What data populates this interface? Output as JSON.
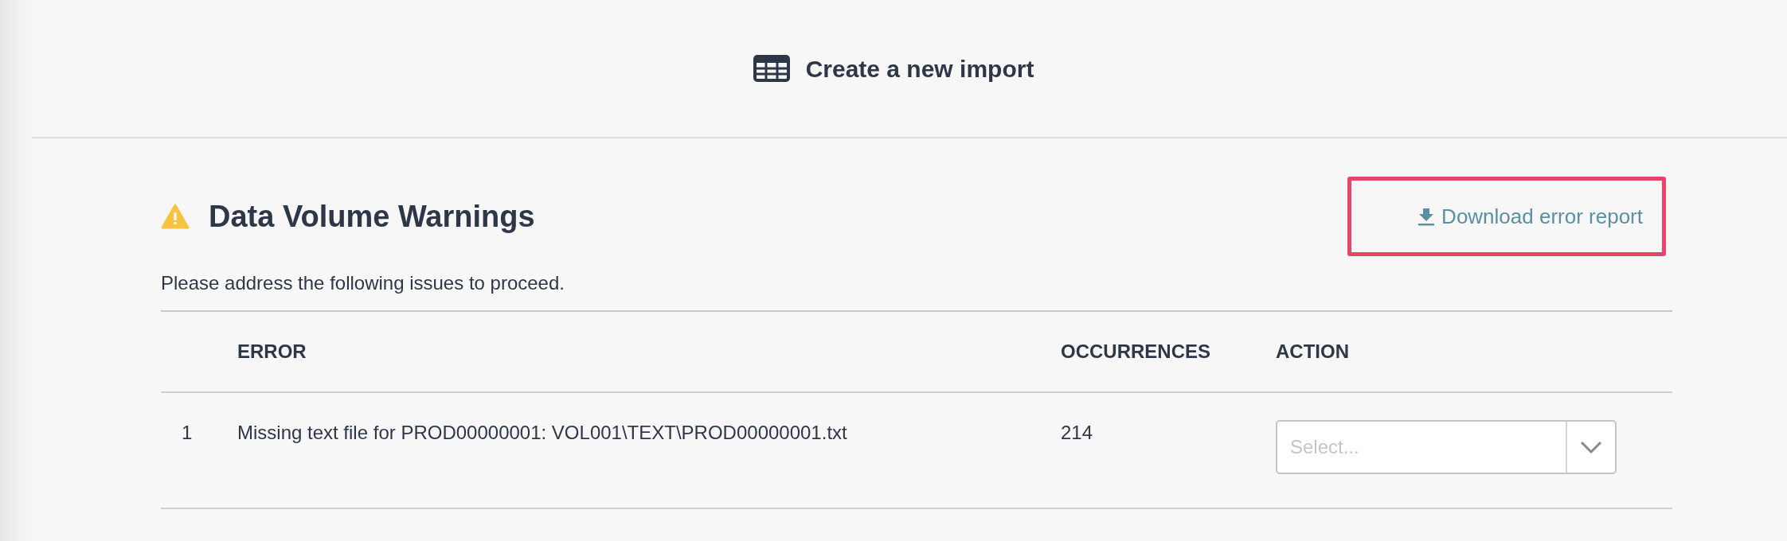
{
  "header": {
    "title": "Create a new import"
  },
  "section": {
    "title": "Data Volume Warnings",
    "download_link": "Download error report",
    "highlighted": true,
    "subtitle": "Please address the following issues to proceed."
  },
  "table": {
    "columns": [
      "ERROR",
      "OCCURRENCES",
      "ACTION"
    ],
    "rows": [
      {
        "number": "1",
        "error": "Missing text file for PROD00000001: VOL001\\TEXT\\PROD00000001.txt",
        "occurrences": "214",
        "action": {
          "placeholder": "Select..."
        }
      }
    ]
  }
}
